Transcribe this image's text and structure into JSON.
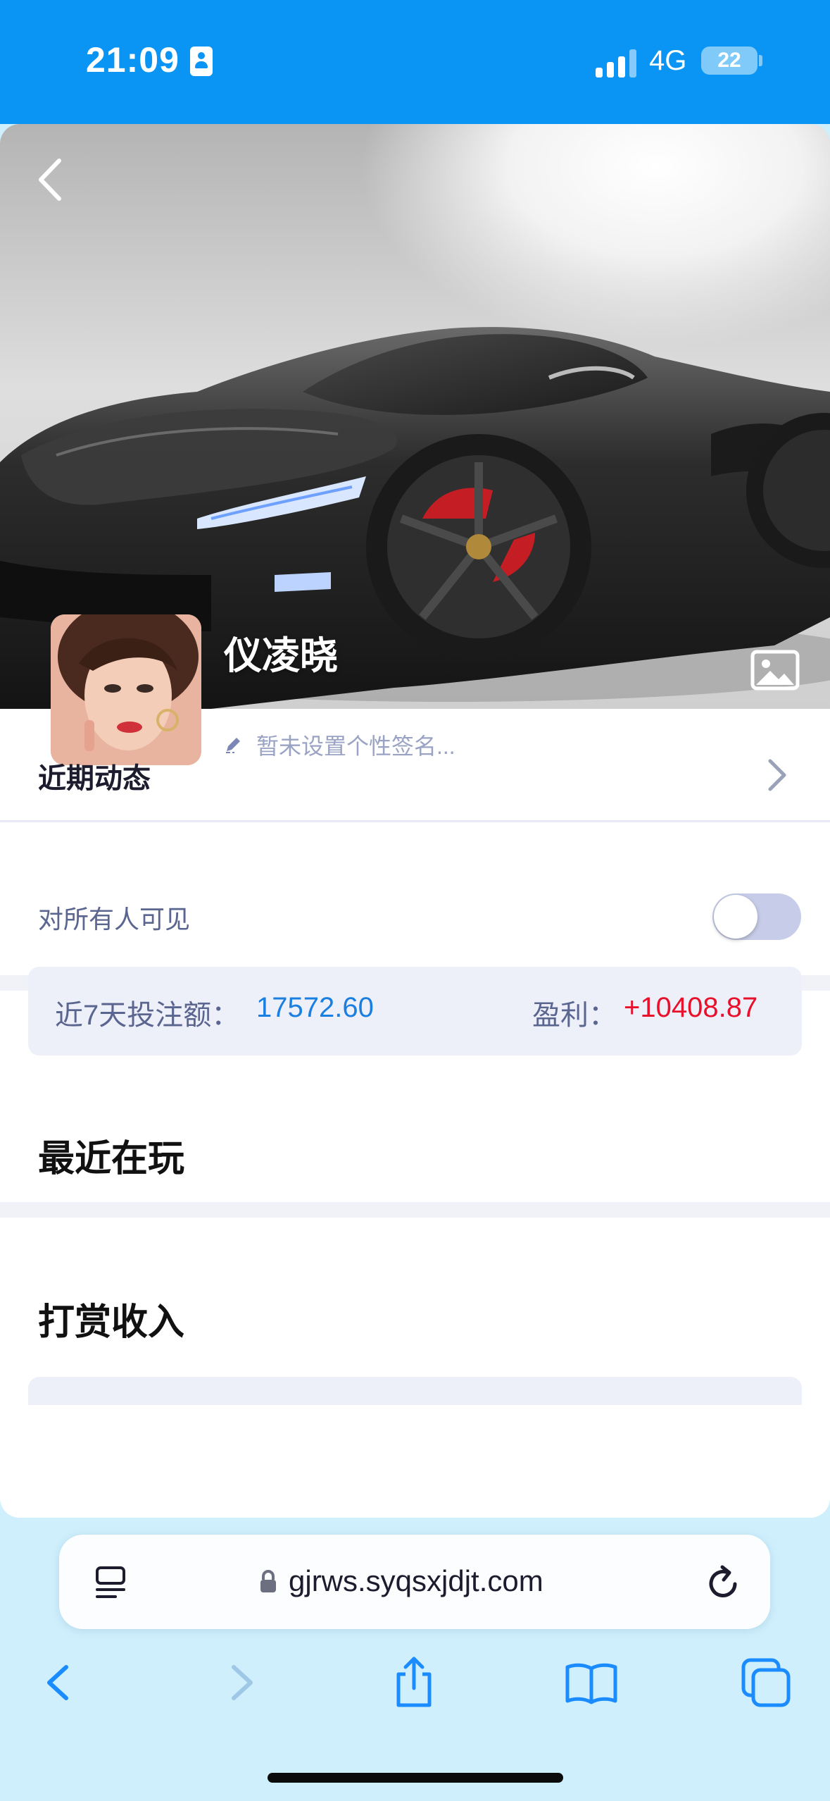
{
  "status_bar": {
    "time": "21:09",
    "network": "4G",
    "battery": "22",
    "icons": [
      "contact-card-icon",
      "signal-icon",
      "battery-icon"
    ]
  },
  "profile": {
    "username": "仪凌晓",
    "signature": "暂未设置个性签名...",
    "icons": [
      "back-chevron-icon",
      "image-icon",
      "edit-pencil-icon"
    ]
  },
  "recent_activity": {
    "label": "近期动态"
  },
  "visibility": {
    "label": "对所有人可见",
    "enabled": false
  },
  "stats": {
    "bet_label": "近7天投注额：",
    "bet_value": "17572.60",
    "profit_label": "盈利：",
    "profit_value": "+10408.87"
  },
  "sections": {
    "recently_playing": "最近在玩",
    "tips_income": "打赏收入"
  },
  "browser": {
    "url": "gjrws.syqsxjdjt.com",
    "toolbar": [
      "back-icon",
      "forward-icon",
      "share-icon",
      "bookmarks-icon",
      "tabs-icon"
    ]
  },
  "colors": {
    "status_bar": "#0a95f4",
    "bet_value": "#1a7fe0",
    "profit_value": "#e8102a",
    "browser_bg": "#cfeffc"
  }
}
